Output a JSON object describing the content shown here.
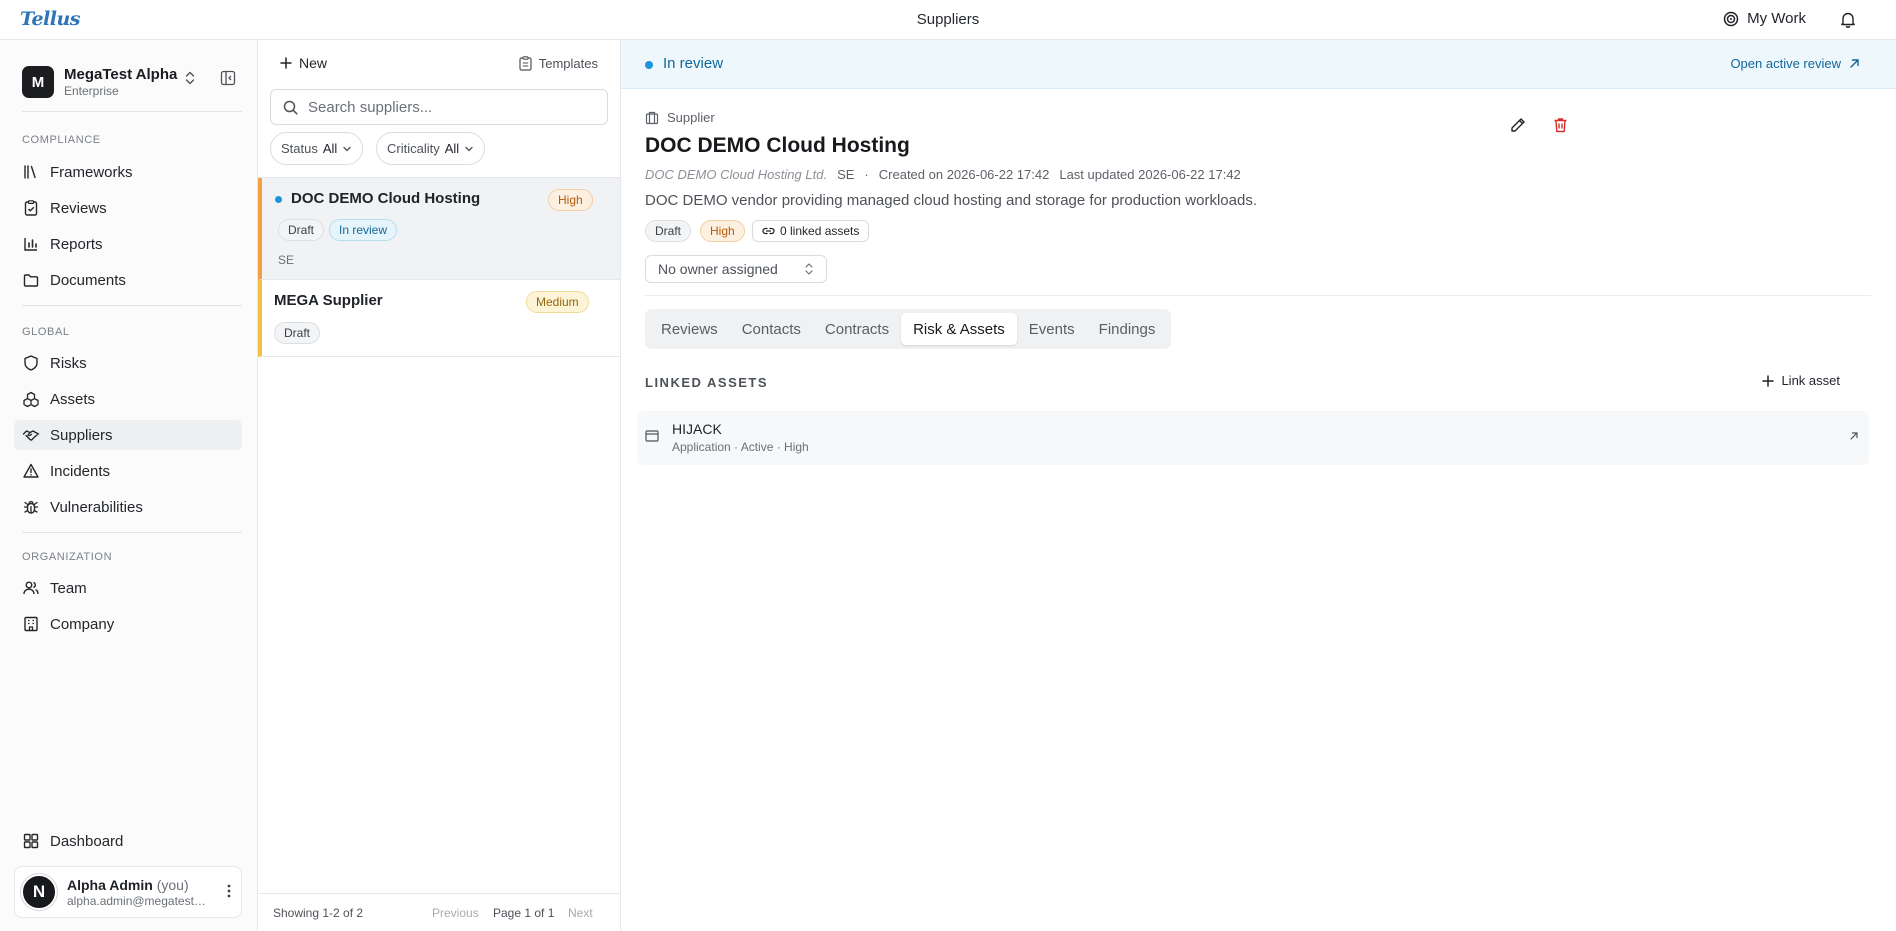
{
  "topbar": {
    "logo": "Tellus",
    "page_title": "Suppliers",
    "my_work_label": "My Work"
  },
  "sidebar": {
    "org_initial": "M",
    "org_name": "MegaTest Alpha",
    "org_plan": "Enterprise",
    "sections": [
      {
        "label": "Compliance",
        "items": [
          {
            "label": "Frameworks",
            "icon": "library-icon"
          },
          {
            "label": "Reviews",
            "icon": "clipboard-check-icon"
          },
          {
            "label": "Reports",
            "icon": "bar-chart-icon"
          },
          {
            "label": "Documents",
            "icon": "folder-icon"
          }
        ]
      },
      {
        "label": "Global",
        "items": [
          {
            "label": "Risks",
            "icon": "shield-icon"
          },
          {
            "label": "Assets",
            "icon": "boxes-icon"
          },
          {
            "label": "Suppliers",
            "icon": "handshake-icon",
            "active": true
          },
          {
            "label": "Incidents",
            "icon": "alert-triangle-icon"
          },
          {
            "label": "Vulnerabilities",
            "icon": "bug-icon"
          }
        ]
      },
      {
        "label": "Organization",
        "items": [
          {
            "label": "Team",
            "icon": "users-icon"
          },
          {
            "label": "Company",
            "icon": "building-icon"
          }
        ]
      }
    ],
    "dashboard_label": "Dashboard",
    "user": {
      "initial": "N",
      "name": "Alpha Admin",
      "you_suffix": "(you)",
      "email": "alpha.admin@megatest.com"
    }
  },
  "list": {
    "new_label": "New",
    "templates_label": "Templates",
    "search_placeholder": "Search suppliers...",
    "filters": [
      {
        "label": "Status",
        "value": "All"
      },
      {
        "label": "Criticality",
        "value": "All"
      }
    ],
    "rows": [
      {
        "name": "DOC DEMO Cloud Hosting",
        "criticality": "High",
        "statuses": [
          "Draft",
          "In review"
        ],
        "country": "SE",
        "selected": true
      },
      {
        "name": "MEGA Supplier",
        "criticality": "Medium",
        "statuses": [
          "Draft"
        ],
        "country": ""
      }
    ],
    "footer": {
      "showing": "Showing 1-2 of 2",
      "previous": "Previous",
      "page": "Page 1 of 1",
      "next": "Next"
    }
  },
  "detail": {
    "review_status": "In review",
    "open_review_label": "Open active review",
    "kicker": "Supplier",
    "title": "DOC DEMO Cloud Hosting",
    "legal_name": "DOC DEMO Cloud Hosting Ltd.",
    "country": "SE",
    "separator": "·",
    "created": "Created on 2026-06-22 17:42",
    "updated": "Last updated 2026-06-22 17:42",
    "description": "DOC DEMO vendor providing managed cloud hosting and storage for production workloads.",
    "chips": {
      "status": "Draft",
      "criticality": "High",
      "linked_assets": "0 linked assets"
    },
    "owner_placeholder": "No owner assigned",
    "tabs": [
      "Reviews",
      "Contacts",
      "Contracts",
      "Risk & Assets",
      "Events",
      "Findings"
    ],
    "active_tab": "Risk & Assets",
    "linked_assets_label": "LINKED ASSETS",
    "link_asset_label": "Link asset",
    "assets": [
      {
        "name": "HIJACK",
        "meta": "Application · Active · High"
      }
    ]
  },
  "colors": {
    "accent": "#1d95d8",
    "high_border": "#f5a044",
    "medium_border": "#f5c04a",
    "delete": "#d0312d"
  }
}
